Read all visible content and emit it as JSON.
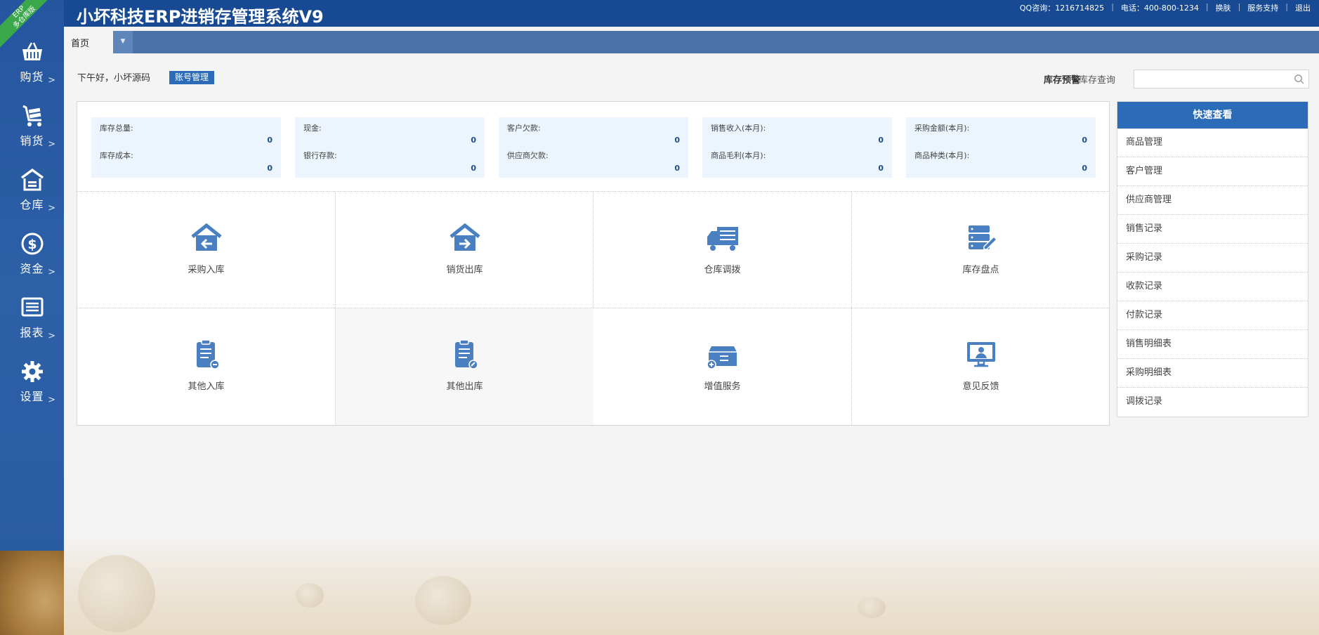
{
  "sidebar": {
    "ribbon_lines": [
      "ERP",
      "多仓库版"
    ],
    "items": [
      {
        "label": "购货",
        "icon": "basket-icon"
      },
      {
        "label": "销货",
        "icon": "cart-icon"
      },
      {
        "label": "仓库",
        "icon": "warehouse-icon"
      },
      {
        "label": "资金",
        "icon": "dollar-icon"
      },
      {
        "label": "报表",
        "icon": "report-icon"
      },
      {
        "label": "设置",
        "icon": "gear-icon"
      }
    ],
    "chevron": ">"
  },
  "header": {
    "title": "小坏科技ERP进销存管理系统V9",
    "qq": "QQ咨询：1216714825",
    "phone": "电话：400-800-1234",
    "skin": "换肤",
    "support": "服务支持",
    "logout": "退出"
  },
  "tabs": {
    "home": "首页"
  },
  "greeting": {
    "text": "下午好，小坏源码",
    "account_button": "账号管理"
  },
  "toolbar": {
    "stock_warning": "库存预警",
    "stock_query": "库存查询",
    "search_value": ""
  },
  "stats": [
    {
      "label1": "库存总量:",
      "value1": "0",
      "label2": "库存成本:",
      "value2": "0"
    },
    {
      "label1": "现金:",
      "value1": "0",
      "label2": "银行存款:",
      "value2": "0"
    },
    {
      "label1": "客户欠款:",
      "value1": "0",
      "label2": "供应商欠款:",
      "value2": "0"
    },
    {
      "label1": "销售收入(本月):",
      "value1": "0",
      "label2": "商品毛利(本月):",
      "value2": "0"
    },
    {
      "label1": "采购金额(本月):",
      "value1": "0",
      "label2": "商品种类(本月):",
      "value2": "0"
    }
  ],
  "actions": [
    {
      "label": "采购入库",
      "icon": "purchase-in-icon"
    },
    {
      "label": "销货出库",
      "icon": "sales-out-icon"
    },
    {
      "label": "仓库调拨",
      "icon": "truck-icon"
    },
    {
      "label": "库存盘点",
      "icon": "inventory-check-icon"
    },
    {
      "label": "其他入库",
      "icon": "clipboard-in-icon"
    },
    {
      "label": "其他出库",
      "icon": "clipboard-out-icon"
    },
    {
      "label": "增值服务",
      "icon": "value-added-icon"
    },
    {
      "label": "意见反馈",
      "icon": "feedback-icon"
    }
  ],
  "quick": {
    "title": "快速查看",
    "items": [
      "商品管理",
      "客户管理",
      "供应商管理",
      "销售记录",
      "采购记录",
      "收款记录",
      "付款记录",
      "销售明细表",
      "采购明细表",
      "调拨记录"
    ]
  },
  "colors": {
    "sidebar": "#2c60a7",
    "header": "#174a92",
    "accent": "#2c6bb8",
    "icon": "#4a7fc1"
  }
}
